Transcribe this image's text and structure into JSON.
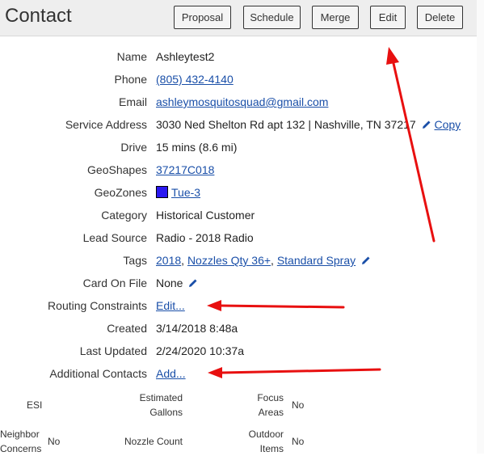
{
  "header": {
    "title": "Contact",
    "buttons": {
      "proposal": "Proposal",
      "schedule": "Schedule",
      "merge": "Merge",
      "edit": "Edit",
      "delete": "Delete"
    }
  },
  "fields": {
    "name": {
      "label": "Name",
      "value": "Ashleytest2"
    },
    "phone": {
      "label": "Phone",
      "value": "(805) 432-4140"
    },
    "email": {
      "label": "Email",
      "value": "ashleymosquitosquad@gmail.com"
    },
    "service_address": {
      "label": "Service Address",
      "value": "3030 Ned Shelton Rd apt 132 | Nashville, TN 37217",
      "copy": "Copy"
    },
    "drive": {
      "label": "Drive",
      "value": "15 mins (8.6 mi)"
    },
    "geoshapes": {
      "label": "GeoShapes",
      "value": "37217C018"
    },
    "geozones": {
      "label": "GeoZones",
      "value": "Tue-3",
      "swatch_color": "#2a18f0"
    },
    "category": {
      "label": "Category",
      "value": "Historical Customer"
    },
    "lead_source": {
      "label": "Lead Source",
      "value": "Radio - 2018 Radio"
    },
    "tags": {
      "label": "Tags",
      "items": [
        "2018",
        "Nozzles Qty 36+",
        "Standard Spray"
      ]
    },
    "card_on_file": {
      "label": "Card On File",
      "value": "None"
    },
    "routing_constraints": {
      "label": "Routing Constraints",
      "value": "Edit..."
    },
    "created": {
      "label": "Created",
      "value": "3/14/2018 8:48a"
    },
    "last_updated": {
      "label": "Last Updated",
      "value": "2/24/2020 10:37a"
    },
    "additional_contacts": {
      "label": "Additional Contacts",
      "value": "Add..."
    }
  },
  "grid": {
    "esi": {
      "label": "ESI",
      "value": ""
    },
    "estimated_gallons": {
      "label_1": "Estimated",
      "label_2": "Gallons",
      "value": ""
    },
    "focus_areas": {
      "label_1": "Focus",
      "label_2": "Areas",
      "value": "No"
    },
    "neighbor_concerns": {
      "label_1": "Neighbor",
      "label_2": "Concerns",
      "value": "No"
    },
    "nozzle_count": {
      "label": "Nozzle Count",
      "value": ""
    },
    "outdoor_items": {
      "label_1": "Outdoor",
      "label_2": "Items",
      "value": "No"
    }
  },
  "icons": {
    "pencil": "pencil-icon",
    "arrow": "red-arrow-annotation"
  },
  "colors": {
    "link": "#1a4fa8",
    "annotation": "#e81010",
    "header_bg": "#eeeeee"
  }
}
